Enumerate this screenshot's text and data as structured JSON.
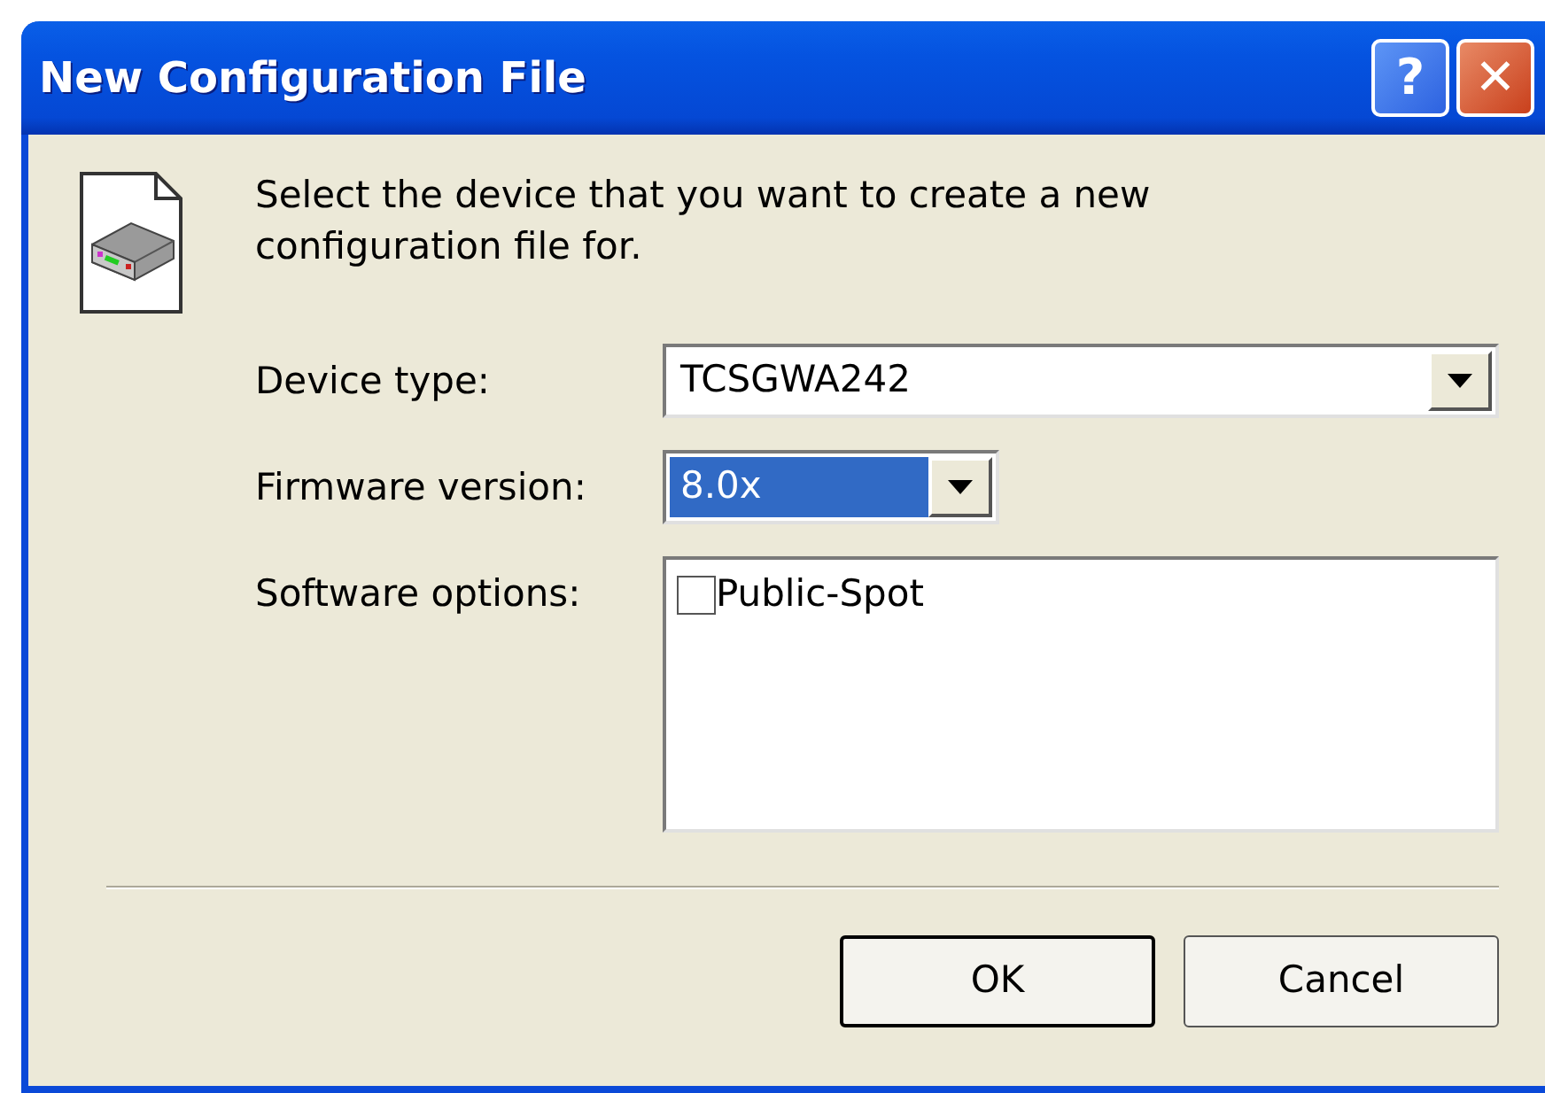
{
  "window": {
    "title": "New Configuration File"
  },
  "title_buttons": [
    {
      "kind": "help",
      "label": "?"
    },
    {
      "kind": "close",
      "label": "✕"
    }
  ],
  "intro": "Select the device that you want to create a new configuration file for.",
  "fields": [
    {
      "kind": "combo",
      "label": "Device type:",
      "value": "TCSGWA242",
      "highlighted": false,
      "wide": true
    },
    {
      "kind": "combo",
      "label": "Firmware version:",
      "value": "8.0x",
      "highlighted": true,
      "wide": false
    },
    {
      "kind": "checklist",
      "label": "Software options:",
      "items": [
        {
          "label": "Public-Spot",
          "checked": false
        }
      ]
    }
  ],
  "buttons": [
    {
      "label": "OK",
      "default": true
    },
    {
      "label": "Cancel",
      "default": false
    }
  ]
}
